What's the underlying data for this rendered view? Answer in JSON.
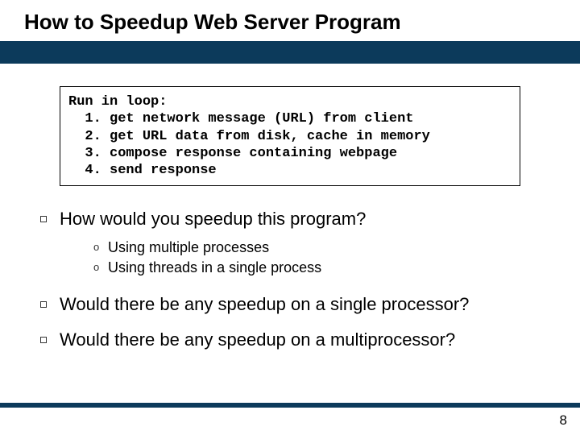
{
  "title": "How to Speedup Web Server Program",
  "code": {
    "l0": "Run in loop:",
    "l1": "  1. get network message (URL) from client",
    "l2": "  2. get URL data from disk, cache in memory",
    "l3": "  3. compose response containing webpage",
    "l4": "  4. send response"
  },
  "q1": "How would you speedup this program?",
  "subs": [
    "Using multiple processes",
    "Using threads in a single process"
  ],
  "q2": "Would there be any speedup on a single processor?",
  "q3": "Would there be any speedup on a multiprocessor?",
  "page": "8"
}
